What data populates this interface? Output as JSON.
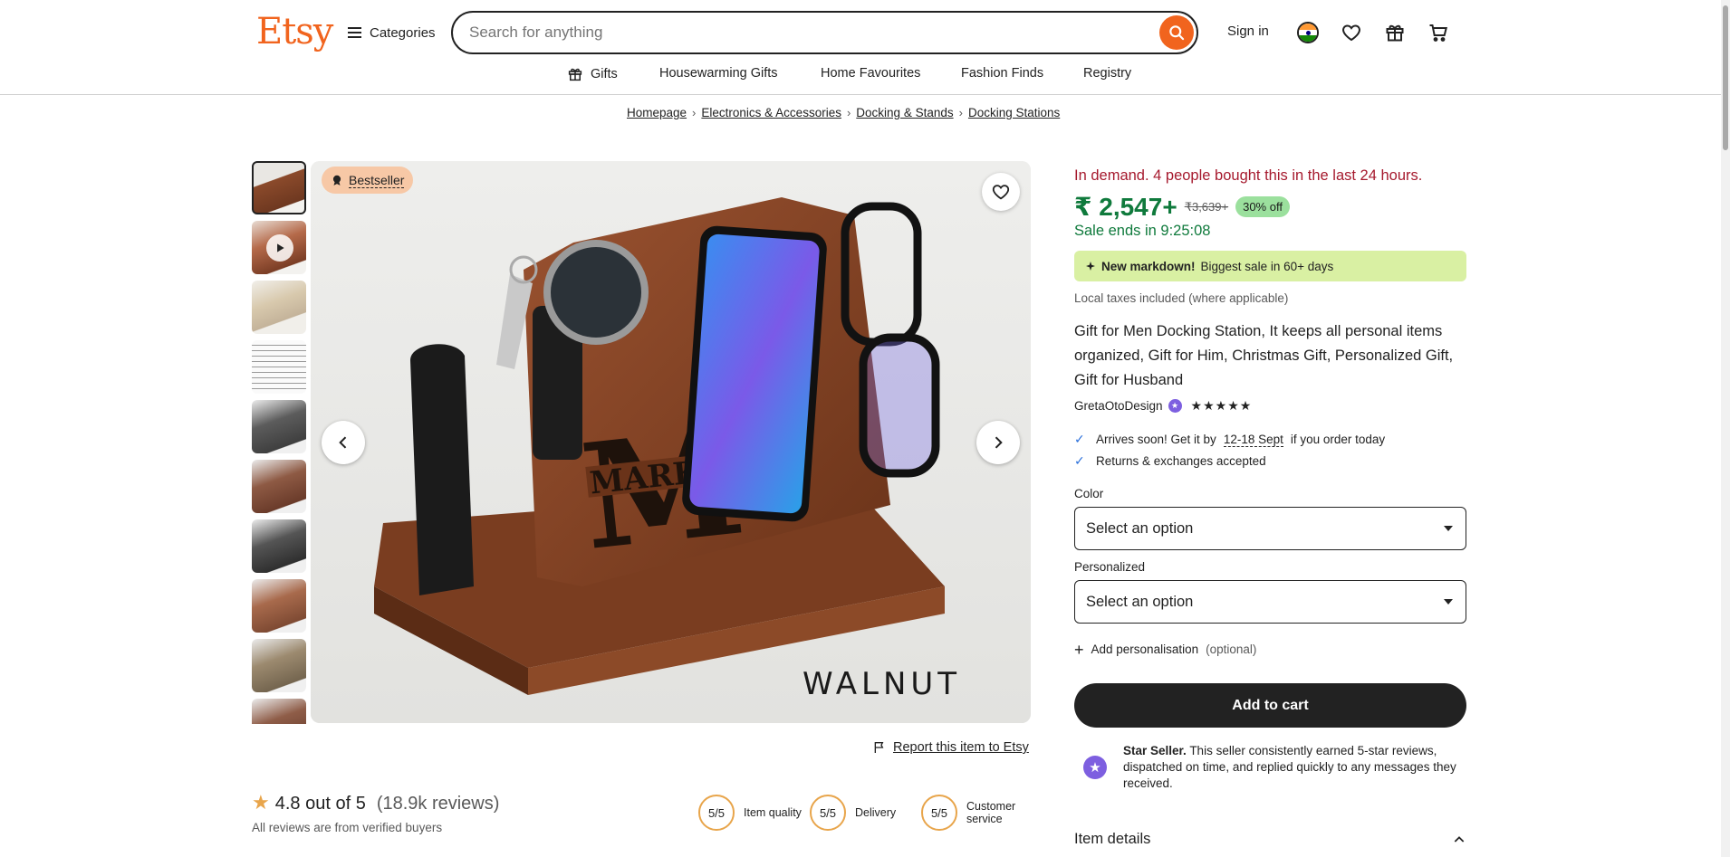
{
  "header": {
    "logo": "Etsy",
    "categories_label": "Categories",
    "search_placeholder": "Search for anything",
    "sign_in": "Sign in",
    "icons": [
      "search-icon",
      "flag-icon",
      "heart-icon",
      "gift-icon",
      "cart-icon"
    ]
  },
  "subnav": {
    "items": [
      "Gifts",
      "Housewarming Gifts",
      "Home Favourites",
      "Fashion Finds",
      "Registry"
    ]
  },
  "breadcrumb": [
    "Homepage",
    "Electronics & Accessories",
    "Docking & Stands",
    "Docking Stations"
  ],
  "gallery": {
    "badge": "Bestseller",
    "image_text": "WALNUT",
    "thumbnail_count": 10,
    "active_thumbnail": 1
  },
  "report_link": "Report this item to Etsy",
  "reviews": {
    "rating": "4.8 out of 5",
    "count": "(18.9k reviews)",
    "verified": "All reviews are from verified buyers",
    "scores": [
      {
        "value": "5/5",
        "label": "Item quality"
      },
      {
        "value": "5/5",
        "label": "Delivery"
      },
      {
        "value": "5/5",
        "label": "Customer service"
      }
    ]
  },
  "product": {
    "demand": "In demand. 4 people bought this in the last 24 hours.",
    "price": "₹ 2,547+",
    "old_price": "₹3,639+",
    "discount": "30% off",
    "sale_ends": "Sale ends in 9:25:08",
    "markdown_bold": "New markdown!",
    "markdown_rest": "Biggest sale in 60+ days",
    "taxes": "Local taxes included (where applicable)",
    "title": "Gift for Men Docking Station, It keeps all personal items organized, Gift for Him, Christmas Gift, Personalized Gift, Gift for Husband",
    "seller": "GretaOtoDesign",
    "stars": "★★★★★",
    "arrives_prefix": "Arrives soon! Get it by",
    "arrives_date": "12-18 Sept",
    "arrives_suffix": "if you order today",
    "returns": "Returns & exchanges accepted",
    "color_label": "Color",
    "color_value": "Select an option",
    "personalized_label": "Personalized",
    "personalized_value": "Select an option",
    "add_personalisation": "Add personalisation",
    "add_personalisation_optional": "(optional)",
    "add_to_cart": "Add to cart",
    "star_seller_bold": "Star Seller.",
    "star_seller_text": "This seller consistently earned 5-star reviews, dispatched on time, and replied quickly to any messages they received.",
    "item_details": "Item details"
  },
  "colors": {
    "brand": "#f1641e",
    "demand": "#a61a2e",
    "sale": "#0f7a3c",
    "markdown_bg": "#d9f0a3",
    "discount_bg": "#9be09d",
    "star_seller": "#7d5fe0"
  }
}
